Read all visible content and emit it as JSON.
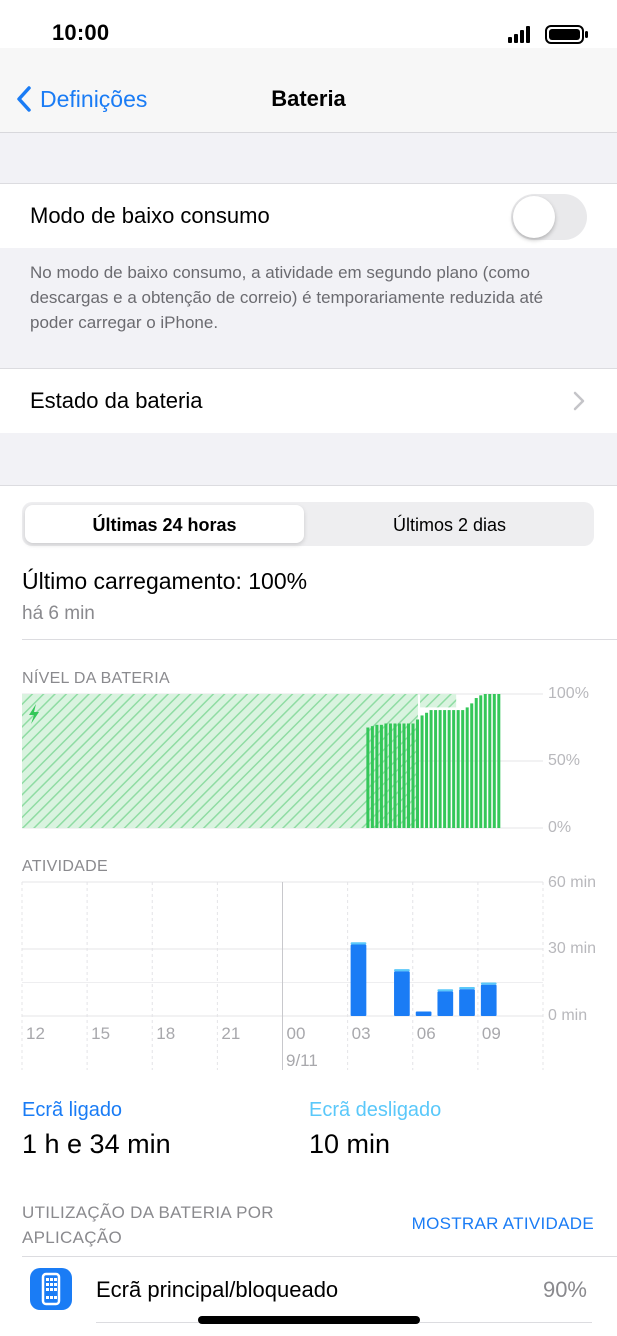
{
  "status_bar": {
    "time": "10:00"
  },
  "nav": {
    "back_label": "Definições",
    "title": "Bateria"
  },
  "low_power": {
    "label": "Modo de baixo consumo",
    "enabled": false,
    "footnote": "No modo de baixo consumo, a atividade em segundo plano (como descargas e a obtenção de correio) é temporariamente reduzida até poder carregar o iPhone."
  },
  "battery_health": {
    "label": "Estado da bateria"
  },
  "range_tabs": {
    "selected": 0,
    "items": [
      "Últimas 24 horas",
      "Últimos 2 dias"
    ]
  },
  "last_charge": {
    "title": "Último carregamento: 100%",
    "ago": "há 6 min"
  },
  "chart_data": [
    {
      "type": "bar",
      "title": "NÍVEL DA BATERIA",
      "y_ticks": [
        "100%",
        "50%",
        "0%"
      ],
      "ylim": [
        0,
        100
      ],
      "charging_hatched_span": [
        0,
        0.76
      ],
      "values": [
        75,
        76,
        77,
        77,
        78,
        78,
        78,
        78,
        78,
        78,
        78,
        81,
        84,
        86,
        88,
        88,
        88,
        88,
        88,
        88,
        88,
        88,
        90,
        93,
        97,
        99,
        100,
        100,
        100,
        100
      ],
      "colors": {
        "level": "#34c759",
        "hatch": "#34c759"
      }
    },
    {
      "type": "bar",
      "title": "ATIVIDADE",
      "y_ticks": [
        "60 min",
        "30 min",
        "0 min"
      ],
      "ylim": [
        0,
        60
      ],
      "x_ticks": [
        "12",
        "15",
        "18",
        "21",
        "00",
        "03",
        "06",
        "09"
      ],
      "x_sub": "9/11",
      "bars": [
        {
          "slot": 15,
          "on": 32,
          "off": 1
        },
        {
          "slot": 17,
          "on": 20,
          "off": 1
        },
        {
          "slot": 18,
          "on": 2,
          "off": 0
        },
        {
          "slot": 19,
          "on": 11,
          "off": 1
        },
        {
          "slot": 20,
          "on": 12,
          "off": 1
        },
        {
          "slot": 21,
          "on": 14,
          "off": 1
        }
      ],
      "colors": {
        "on": "#1a7cf5",
        "off": "#5ac8fa"
      }
    }
  ],
  "screen_on": {
    "label": "Ecrã ligado",
    "value": "1 h e 34 min"
  },
  "screen_off": {
    "label": "Ecrã desligado",
    "value": "10 min"
  },
  "usage": {
    "title": "UTILIZAÇÃO DA BATERIA POR APLICAÇÃO",
    "show_activity": "MOSTRAR ATIVIDADE",
    "apps": [
      {
        "name": "Ecrã principal/bloqueado",
        "percent": "90%",
        "icon": "home-screen-icon"
      }
    ]
  },
  "colors": {
    "accent": "#1a7cf5",
    "green": "#34c759",
    "light_blue": "#5ac8fa"
  }
}
